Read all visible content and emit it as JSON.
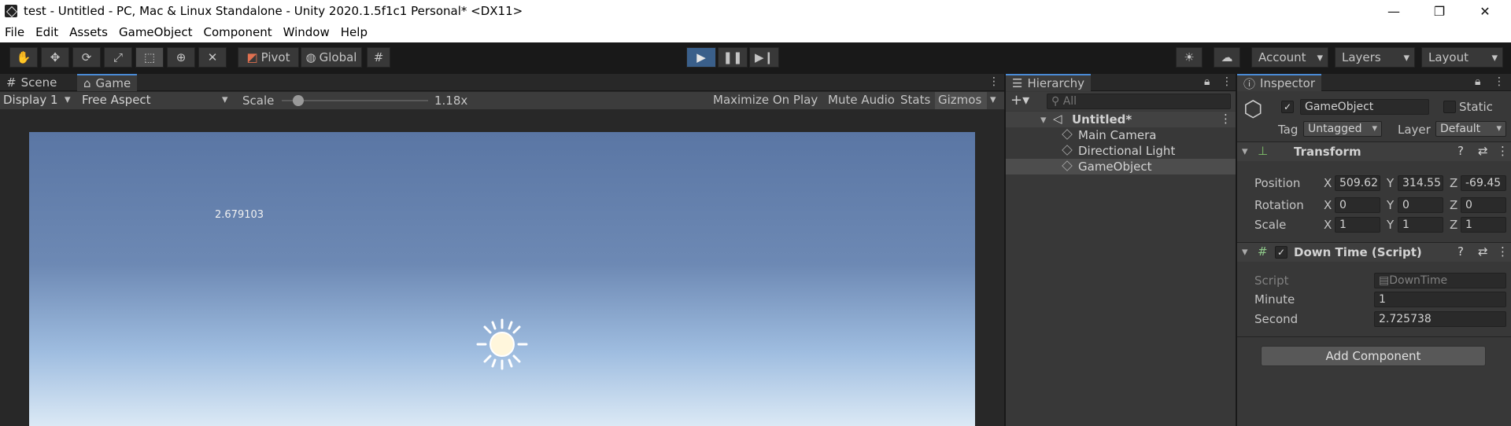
{
  "window": {
    "title": "test - Untitled - PC, Mac & Linux Standalone - Unity 2020.1.5f1c1 Personal* <DX11>",
    "minimize": "—",
    "restore": "❐",
    "close": "✕"
  },
  "menu": [
    "File",
    "Edit",
    "Assets",
    "GameObject",
    "Component",
    "Window",
    "Help"
  ],
  "toolbar": {
    "pivot": "Pivot",
    "global": "Global",
    "account": "Account",
    "layers": "Layers",
    "layout": "Layout"
  },
  "game_view": {
    "tabs": {
      "scene": "Scene",
      "game": "Game"
    },
    "display": "Display 1",
    "aspect": "Free Aspect",
    "scale_label": "Scale",
    "scale_value": "1.18x",
    "maximize": "Maximize On Play",
    "mute": "Mute Audio",
    "stats": "Stats",
    "gizmos": "Gizmos",
    "overlay_text": "2.679103"
  },
  "hierarchy": {
    "tab": "Hierarchy",
    "search_placeholder": "All",
    "scene": "Untitled*",
    "items": [
      "Main Camera",
      "Directional Light",
      "GameObject"
    ]
  },
  "inspector": {
    "tab": "Inspector",
    "name": "GameObject",
    "static": "Static",
    "tag_label": "Tag",
    "tag": "Untagged",
    "layer_label": "Layer",
    "layer": "Default",
    "transform": {
      "title": "Transform",
      "position_label": "Position",
      "rotation_label": "Rotation",
      "scale_label": "Scale",
      "position": {
        "x": "509.62",
        "y": "314.55",
        "z": "-69.45"
      },
      "rotation": {
        "x": "0",
        "y": "0",
        "z": "0"
      },
      "scale": {
        "x": "1",
        "y": "1",
        "z": "1"
      }
    },
    "script": {
      "title": "Down Time (Script)",
      "script_label": "Script",
      "script_value": "DownTime",
      "minute_label": "Minute",
      "minute": "1",
      "second_label": "Second",
      "second": "2.725738"
    },
    "add_component": "Add Component"
  },
  "axis_labels": {
    "x": "X",
    "y": "Y",
    "z": "Z"
  },
  "colors": {
    "accent": "#4a8bd6",
    "play": "#3a5f8a",
    "panel": "#383838",
    "sky_top": "#5a76a4",
    "sky_bottom": "#dbe9f5"
  }
}
